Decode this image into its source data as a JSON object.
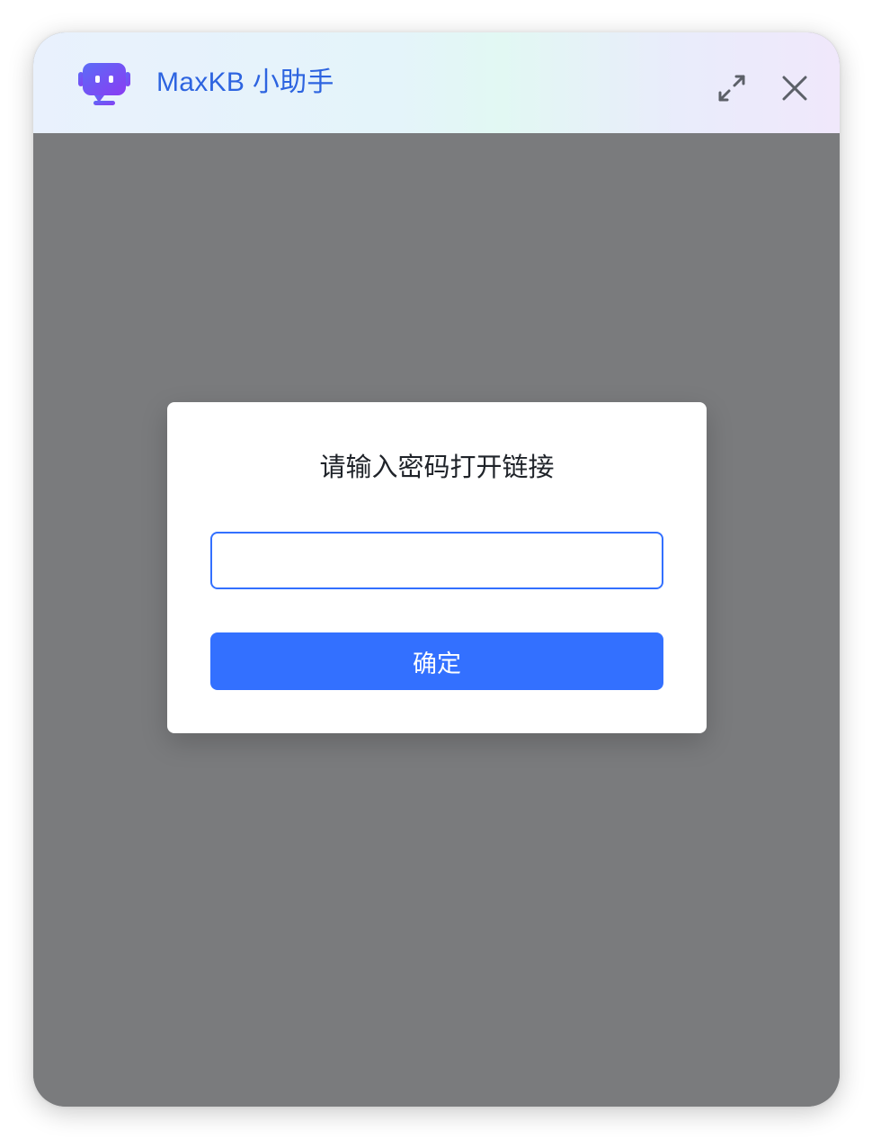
{
  "header": {
    "title": "MaxKB 小助手",
    "icons": {
      "logo": "robot-chat-logo",
      "expand": "expand-arrows-icon",
      "close": "close-icon"
    }
  },
  "dialog": {
    "title": "请输入密码打开链接",
    "password_value": "",
    "confirm_label": "确定"
  },
  "colors": {
    "accent": "#3370ff",
    "title_text": "#2d64e0",
    "overlay": "#7a7b7d",
    "logo": "#6a4df5"
  }
}
